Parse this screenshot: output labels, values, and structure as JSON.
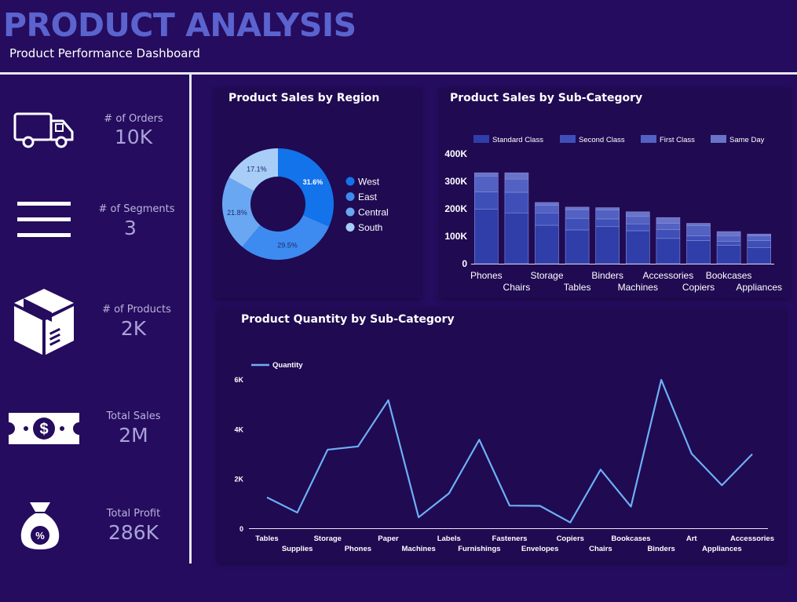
{
  "header": {
    "title": "PRODUCT ANALYSIS",
    "subtitle": "Product Performance Dashboard"
  },
  "kpis": [
    {
      "label": "# of Orders",
      "value": "10K",
      "icon": "truck-icon"
    },
    {
      "label": "# of Segments",
      "value": "3",
      "icon": "menu-lines-icon"
    },
    {
      "label": "# of Products",
      "value": "2K",
      "icon": "package-box-icon"
    },
    {
      "label": "Total Sales",
      "value": "2M",
      "icon": "dollar-bill-icon"
    },
    {
      "label": "Total Profit",
      "value": "286K",
      "icon": "money-bag-icon"
    }
  ],
  "colors": {
    "background": "#250c5e",
    "panel": "#200a52",
    "title": "#5b63cf",
    "kpi_value": "#a8a3d8",
    "line": "#6db0f5"
  },
  "chart_data": [
    {
      "type": "pie",
      "variant": "donut",
      "title": "Product Sales by Region",
      "labels": [
        "West",
        "East",
        "Central",
        "South"
      ],
      "values": [
        31.6,
        29.5,
        21.8,
        17.1
      ],
      "value_labels": [
        "31.6%",
        "29.5%",
        "21.8%",
        "17.1%"
      ],
      "colors": [
        "#1273eb",
        "#3d8bf0",
        "#6aa7f2",
        "#a8cdf7"
      ],
      "legend": "right"
    },
    {
      "type": "bar",
      "stacked": true,
      "title": "Product Sales by Sub-Category",
      "categories": [
        "Phones",
        "Chairs",
        "Storage",
        "Tables",
        "Binders",
        "Machines",
        "Accessories",
        "Copiers",
        "Bookcases",
        "Appliances"
      ],
      "series": [
        {
          "name": "Standard Class",
          "color": "#2f3ea8",
          "values": [
            198000,
            185000,
            140000,
            123000,
            135000,
            120000,
            92000,
            84000,
            67000,
            58000
          ]
        },
        {
          "name": "Second Class",
          "color": "#3f4fb8",
          "values": [
            63000,
            75000,
            45000,
            42000,
            28000,
            25000,
            32000,
            17000,
            15000,
            26000
          ]
        },
        {
          "name": "First Class",
          "color": "#5361c2",
          "values": [
            58000,
            48000,
            28000,
            32000,
            33000,
            27000,
            23000,
            38000,
            20000,
            17000
          ]
        },
        {
          "name": "Same Day",
          "color": "#6a73c8",
          "values": [
            12000,
            23000,
            10000,
            9000,
            8000,
            17000,
            21000,
            8000,
            15000,
            7000
          ]
        }
      ],
      "ylim": [
        0,
        400000
      ],
      "yticks": [
        "0",
        "100K",
        "200K",
        "300K",
        "400K"
      ],
      "legend": "top"
    },
    {
      "type": "line",
      "title": "Product Quantity by Sub-Category",
      "categories": [
        "Tables",
        "Supplies",
        "Storage",
        "Phones",
        "Paper",
        "Machines",
        "Labels",
        "Furnishings",
        "Fasteners",
        "Envelopes",
        "Copiers",
        "Chairs",
        "Bookcases",
        "Binders",
        "Art",
        "Appliances",
        "Accessories"
      ],
      "series": [
        {
          "name": "Quantity",
          "color": "#6db0f5",
          "values": [
            1240,
            630,
            3160,
            3290,
            5150,
            440,
            1400,
            3560,
            910,
            900,
            230,
            2360,
            870,
            5970,
            3000,
            1730,
            2980
          ]
        }
      ],
      "ylim": [
        0,
        6000
      ],
      "yticks": [
        "0",
        "2K",
        "4K",
        "6K"
      ],
      "legend": "top-left"
    }
  ]
}
